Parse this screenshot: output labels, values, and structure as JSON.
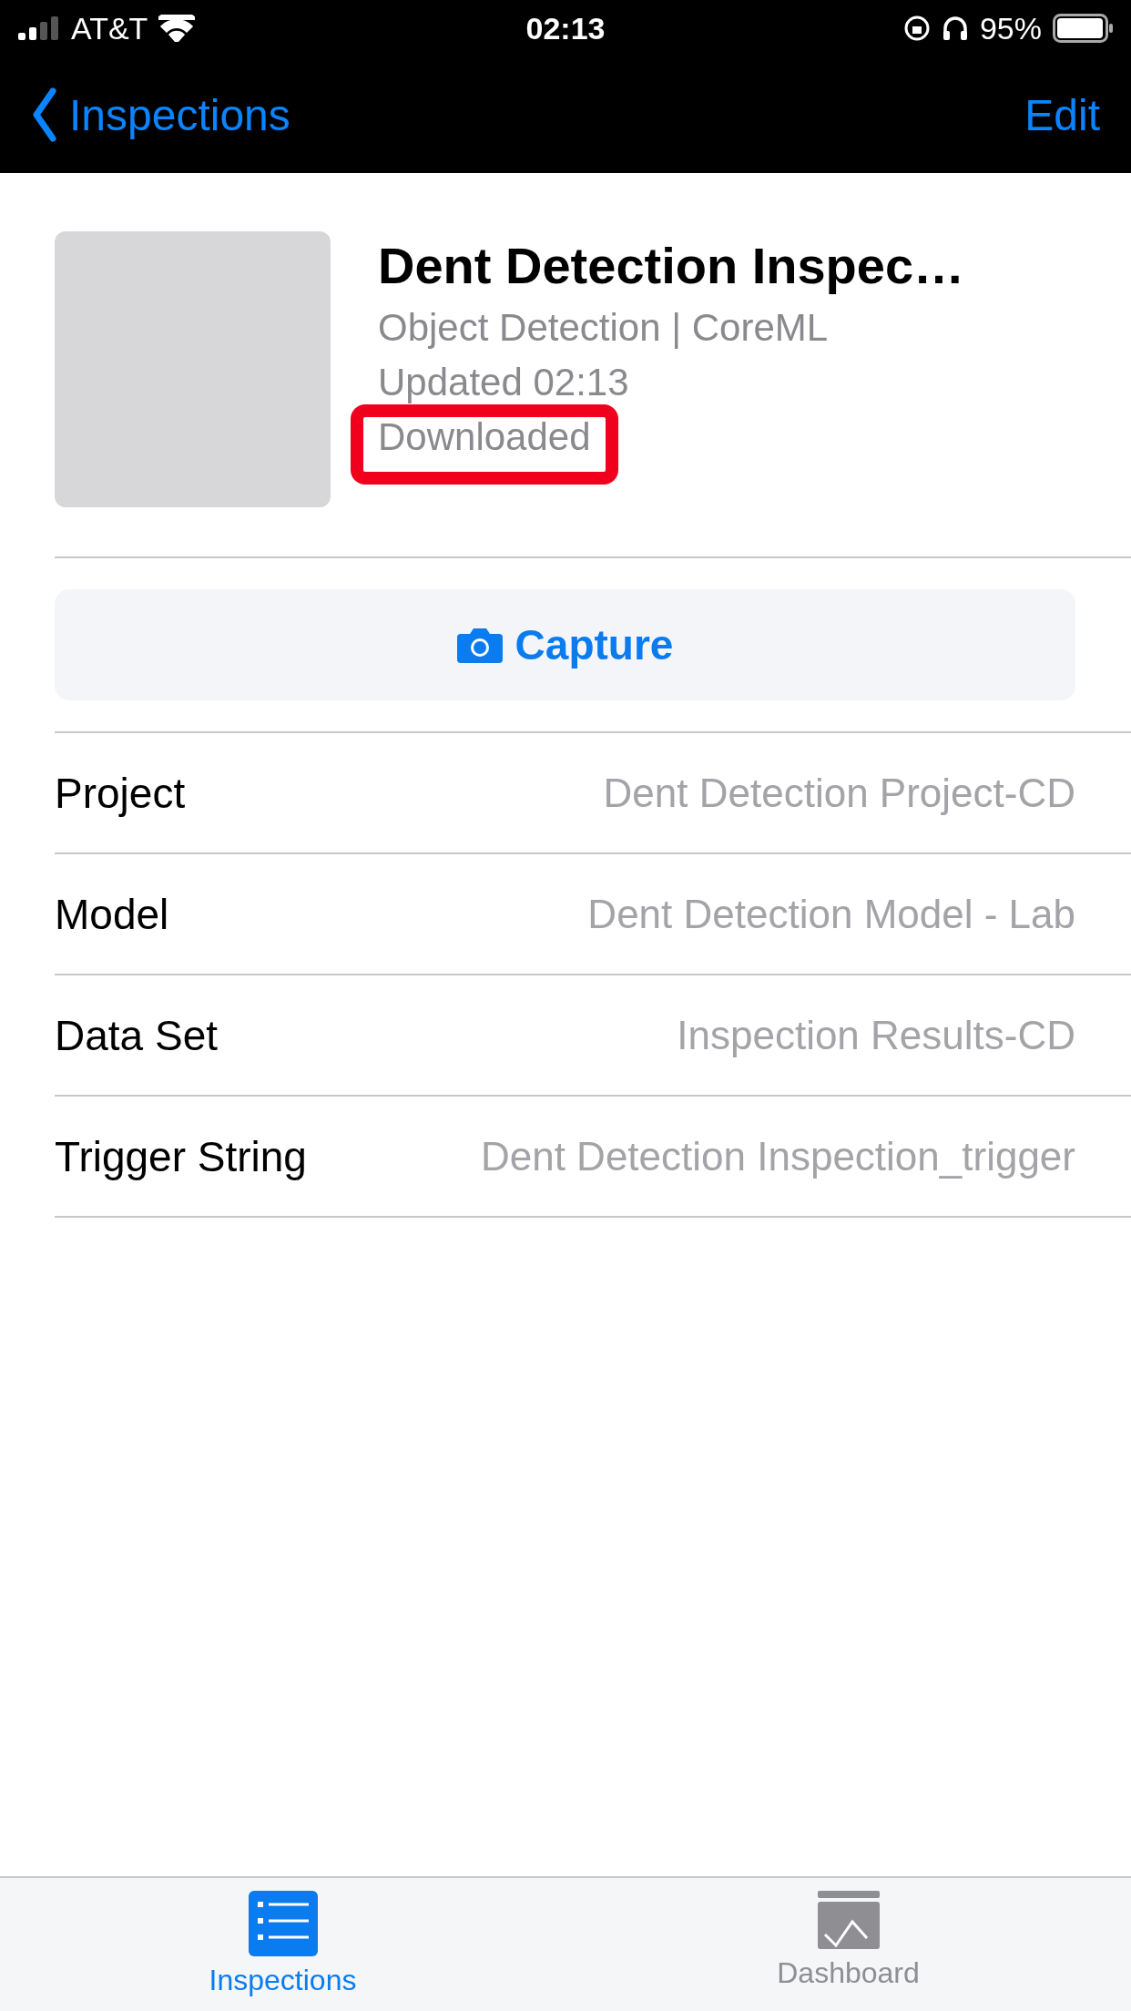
{
  "status_bar": {
    "carrier": "AT&T",
    "time": "02:13",
    "battery": "95%"
  },
  "nav_bar": {
    "back": "Inspections",
    "action": "Edit"
  },
  "inspection": {
    "title": "Dent Detection Inspec…",
    "subtitle": "Object Detection | CoreML",
    "updated": "Updated 02:13",
    "status": "Downloaded",
    "status_highlighted": true
  },
  "capture_button": "Capture",
  "details": [
    {
      "label": "Project",
      "value": "Dent Detection Project-CD"
    },
    {
      "label": "Model",
      "value": "Dent Detection Model - Lab"
    },
    {
      "label": "Data Set",
      "value": "Inspection Results-CD"
    },
    {
      "label": "Trigger String",
      "value": "Dent Detection Inspection_trigger"
    }
  ],
  "tabs": [
    {
      "label": "Inspections",
      "kind": "list",
      "selected": true
    },
    {
      "label": "Dashboard",
      "kind": "chart",
      "selected": false
    }
  ]
}
